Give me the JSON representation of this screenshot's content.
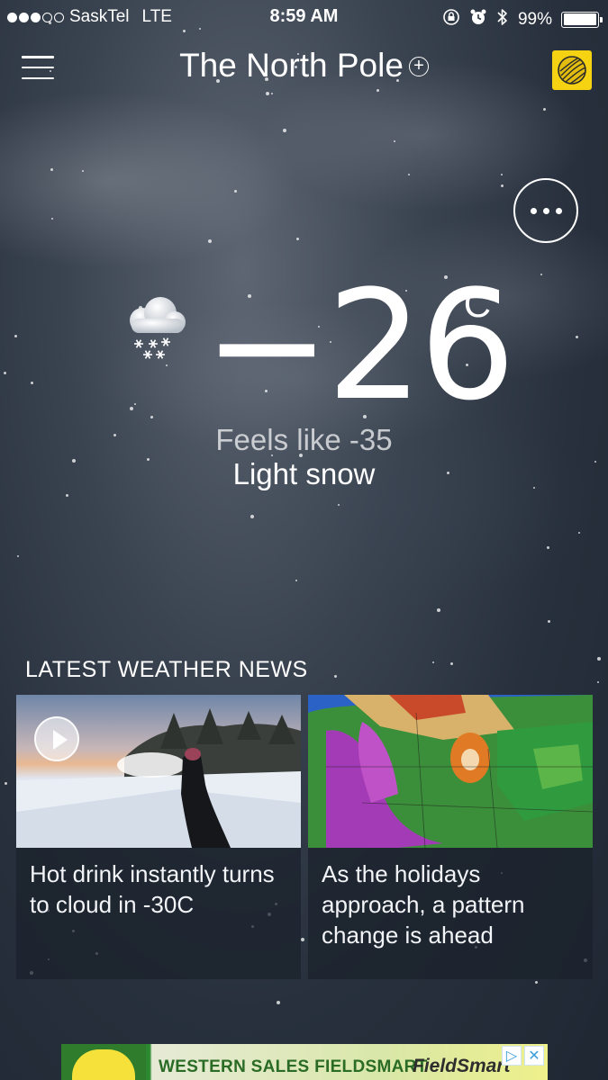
{
  "status_bar": {
    "carrier": "SaskTel",
    "network": "LTE",
    "time": "8:59 AM",
    "battery": "99%",
    "battery_level": 0.99,
    "signal_bars": 3
  },
  "header": {
    "location": "The North Pole",
    "add_location_icon": "plus-circle-icon",
    "brand_icon": "weather-network-globe-icon"
  },
  "current": {
    "temperature": "−26",
    "unit": "°C",
    "feels_like": "Feels like -35",
    "condition": "Light snow",
    "condition_icon": "light-snow-cloud-icon"
  },
  "news": {
    "heading": "LATEST WEATHER NEWS",
    "articles": [
      {
        "title": "Hot drink instantly turns to cloud in -30C",
        "media": "video"
      },
      {
        "title": "As the holidays approach, a pattern change is ahead",
        "media": "map"
      }
    ]
  },
  "ad": {
    "text": "WESTERN SALES FIELDSMART",
    "brand": "FieldSmart"
  },
  "colors": {
    "background": "#27303c",
    "brand_yellow": "#f5d312",
    "card_bg": "#1a212b"
  }
}
